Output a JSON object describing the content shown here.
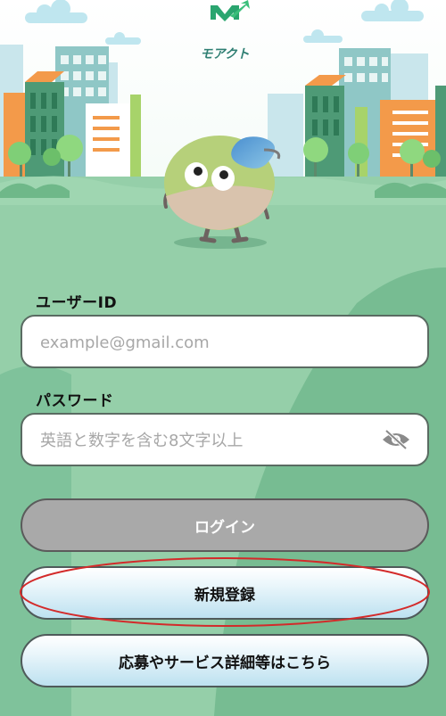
{
  "app": {
    "logo_text": "モアクト"
  },
  "login_form": {
    "user_id_label": "ユーザーID",
    "user_id_placeholder": "example@gmail.com",
    "password_label": "パスワード",
    "password_placeholder": "英語と数字を含む8文字以上",
    "toggle_visibility_icon": "eye-slash-icon"
  },
  "buttons": {
    "login_label": "ログイン",
    "register_label": "新規登録",
    "info_label": "応募やサービス詳細等はこちら"
  },
  "colors": {
    "background_green": "#80c09c",
    "login_button": "#a9a9a9",
    "highlight_ellipse": "#d32a2a"
  }
}
